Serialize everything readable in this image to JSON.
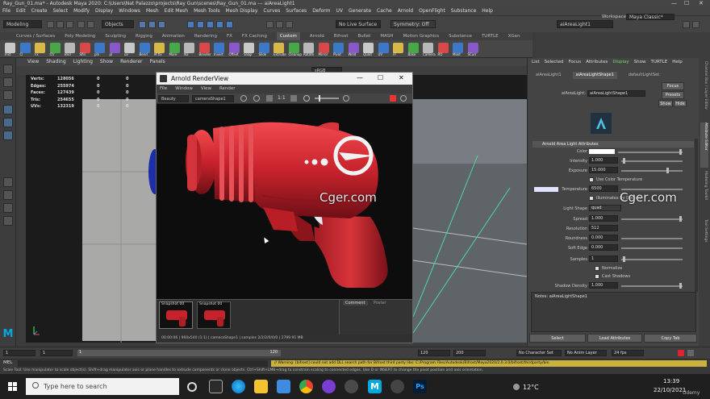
{
  "title_bar": {
    "title": "Ray_Gun_01.ma* - Autodesk Maya 2020: C:\\Users\\Nat Palazzo\\projects\\Ray Gun\\scenes\\Ray_Gun_01.ma --- aiAreaLight1",
    "minimize": "—",
    "maximize": "☐",
    "close": "✕"
  },
  "menu_bar": [
    "File",
    "Edit",
    "Create",
    "Select",
    "Modify",
    "Display",
    "Windows",
    "Mesh",
    "Edit Mesh",
    "Mesh Tools",
    "Mesh Display",
    "Curves",
    "Surfaces",
    "Deform",
    "UV",
    "Generate",
    "Cache",
    "Arnold",
    "OpenFlight",
    "Substance",
    "Help"
  ],
  "status_line": {
    "mode": "Modeling",
    "objects_label": "Objects",
    "live_surface": "No Live Surface",
    "symmetry": "Symmetry: Off",
    "object_field": "aiAreaLight1",
    "workspace_label": "Workspace :",
    "workspace_value": "Maya Classic*"
  },
  "shelf_tabs": [
    "Curves / Surfaces",
    "Poly Modeling",
    "Sculpting",
    "Rigging",
    "Animation",
    "Rendering",
    "FX",
    "FX Caching",
    "Custom",
    "Arnold",
    "Bifrost",
    "Bullet",
    "MASH",
    "Motion Graphics",
    "Substance",
    "TURTLE",
    "XGen"
  ],
  "shelf_active": "Custom",
  "shelf_buttons": [
    "Inst",
    "Cl",
    "Fx",
    "Ctr",
    "Bnd",
    "Sfill",
    "pln",
    "pl",
    "uv",
    "Bend",
    "M.fix",
    "More",
    "N3",
    "Beveler",
    "Invert",
    "Offset",
    "Snap",
    "Slide",
    "Extrude",
    "Cleanup",
    "Rotate",
    "Mirror",
    "Pivot",
    "Weld",
    "Quad",
    "UV",
    "FF",
    "Bake",
    "Camera",
    "RO",
    "Mold",
    "SCurr"
  ],
  "viewport": {
    "menu": [
      "View",
      "Shading",
      "Lighting",
      "Show",
      "Renderer",
      "Panels"
    ],
    "color_space": "sRGB gamma",
    "hud": [
      {
        "label": "Verts:",
        "a": "128056",
        "b": "0",
        "c": "0"
      },
      {
        "label": "Edges:",
        "a": "255974",
        "b": "0",
        "c": "0"
      },
      {
        "label": "Faces:",
        "a": "127439",
        "b": "0",
        "c": "0"
      },
      {
        "label": "Tris:",
        "a": "254655",
        "b": "0",
        "c": "0"
      },
      {
        "label": "UVs:",
        "a": "132319",
        "b": "0",
        "c": "0"
      }
    ]
  },
  "render_view": {
    "title": "Arnold RenderView",
    "menu": [
      "File",
      "Window",
      "View",
      "Render"
    ],
    "aov": "Beauty",
    "camera": "cameraShape1",
    "ratio": "1:1",
    "snapshots": [
      "Snapshot 00",
      "Snapshot 00"
    ],
    "tabs": [
      "Comment",
      "Poster"
    ],
    "status": "00:00:06 | 960x540 (1:1) | cameraShape1 | samples 2/2/2/0/0/0 | 2799.91 MB"
  },
  "attribute_editor": {
    "menu": [
      "List",
      "Selected",
      "Focus",
      "Attributes",
      "Display",
      "Show",
      "TURTLE",
      "Help"
    ],
    "tabs": [
      "aiAreaLight1",
      "aiAreaLightShape1",
      "defaultLightSet"
    ],
    "active_tab": "aiAreaLightShape1",
    "node_label": "aiAreaLight:",
    "node_value": "aiAreaLightShape1",
    "focus_btn": "Focus",
    "presets_btn": "Presets",
    "show_btn": "Show",
    "hide_btn": "Hide",
    "section_title": "Arnold Area Light Attributes",
    "rows": {
      "color": "Color",
      "intensity_label": "Intensity",
      "intensity": "1.000",
      "exposure_label": "Exposure",
      "exposure": "15.000",
      "use_color_temp": "Use Color Temperature",
      "temperature_label": "Temperature",
      "temperature": "6500",
      "illuminates": "Illuminates By Default",
      "light_shape_label": "Light Shape",
      "light_shape": "quad",
      "spread_label": "Spread",
      "spread": "1.000",
      "resolution_label": "Resolution",
      "resolution": "512",
      "roundness_label": "Roundness",
      "roundness": "0.000",
      "soft_edge_label": "Soft Edge",
      "soft_edge": "0.000",
      "samples_label": "Samples",
      "samples": "1",
      "normalize": "Normalize",
      "cast_shadows": "Cast Shadows",
      "shadow_density_label": "Shadow Density",
      "shadow_density": "1.000"
    },
    "notes": "Notes:  aiAreaLightShape1",
    "select_btn": "Select",
    "load_btn": "Load Attributes",
    "copy_btn": "Copy Tab"
  },
  "side_tabs": [
    "Channel Box / Layer Editor",
    "Attribute Editor",
    "Modeling Toolkit",
    "Tool Settings"
  ],
  "timeline": {
    "start": "1",
    "start2": "1",
    "current": "1",
    "range_end": "120",
    "end": "120",
    "end2": "200",
    "char_set": "No Character Set",
    "anim_layer": "No Anim Layer",
    "fps": "24 fps"
  },
  "command_line": {
    "lang": "MEL",
    "warning": "// Warning: [bifrost] could not add DLL search path for Bifrost third party libs: C:/Program Files/Autodesk/Bifrost/Maya2020/2.0.3.0/bifrost/thirdparty/bin"
  },
  "help_line": "Scale Tool: Use manipulator to scale object(s). Shift+drag manipulator axis or plane handles to extrude components or clone objects. Ctrl+Shift+LMB+drag to constrain scaling to connected edges. Use D or INSERT to change the pivot position and axis orientation.",
  "watermarks": [
    "Cger.com",
    "Cger.com"
  ],
  "taskbar": {
    "search": "Type here to search",
    "temp": "12°C",
    "time": "13:39",
    "date": "22/10/2021",
    "watermark_small": "Udemy"
  },
  "colors": {
    "maya_blue": "#00a9e0",
    "gun_red": "#c8232c",
    "panel": "#444444"
  }
}
